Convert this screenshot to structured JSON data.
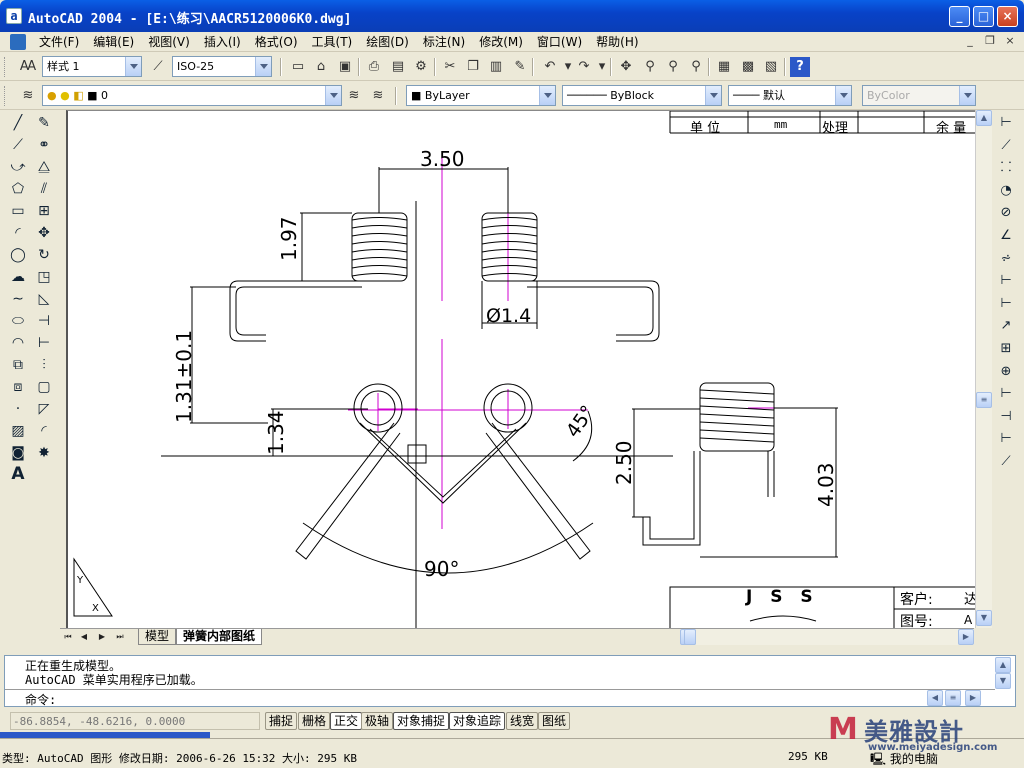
{
  "window": {
    "title": "AutoCAD 2004 - [E:\\练习\\AACR5120006K0.dwg]",
    "app_icon_letter": "a",
    "controls": {
      "minimize": "_",
      "maximize": "□",
      "close": "×"
    }
  },
  "menu": {
    "items": [
      "文件(F)",
      "编辑(E)",
      "视图(V)",
      "插入(I)",
      "格式(O)",
      "工具(T)",
      "绘图(D)",
      "标注(N)",
      "修改(M)",
      "窗口(W)",
      "帮助(H)"
    ],
    "mdi_controls": {
      "minimize": "_",
      "restore": "❐",
      "close": "×"
    }
  },
  "toolbar_styles": {
    "text_style": "样式 1",
    "dim_style": "ISO-25"
  },
  "toolbar_layers": {
    "layer": "0",
    "color": "ByLayer",
    "linetype": "ByBlock",
    "lineweight": "默认",
    "plotstyle": "ByColor"
  },
  "drawing": {
    "dimensions": {
      "d350": "3.50",
      "d197": "1.97",
      "d014": "Ø1.4",
      "d131": "1.31±0.1",
      "d134": "1.34",
      "d45": "45°",
      "d90": "90°",
      "d250": "2.50",
      "d403": "4.03"
    },
    "title_block": {
      "unit_label": "单 位",
      "unit_value": "mm",
      "treat_label": "处理",
      "margin_label": "余 量",
      "logo": "J S S",
      "customer_label": "客户:",
      "customer_value": "达",
      "drawing_no_label": "图号:",
      "drawing_no_value": "A"
    },
    "ucs_labels": {
      "y": "Y",
      "x": "X"
    }
  },
  "layout_tabs": {
    "tabs": [
      "模型",
      "弹簧内部图纸"
    ],
    "active": 1
  },
  "command_window": {
    "lines": [
      "正在重生成模型。",
      "AutoCAD 菜单实用程序已加载。"
    ],
    "prompt": "命令:"
  },
  "status_bar": {
    "coords": "-86.8854, -48.6216, 0.0000",
    "buttons": [
      "捕捉",
      "栅格",
      "正交",
      "极轴",
      "对象捕捉",
      "对象追踪",
      "线宽",
      "图纸"
    ]
  },
  "explorer": {
    "detail": "类型: AutoCAD 图形 修改日期: 2006-6-26 15:32 大小: 295 KB",
    "size": "295 KB",
    "computer": "我的电脑"
  },
  "watermark": {
    "text": "美雅設計",
    "url": "www.meiyadesign.com"
  },
  "colors": {
    "titlebar": "#0a4fd6",
    "chrome": "#ece9d8",
    "center_line": "#d000d0",
    "drawing_line": "#000000"
  }
}
